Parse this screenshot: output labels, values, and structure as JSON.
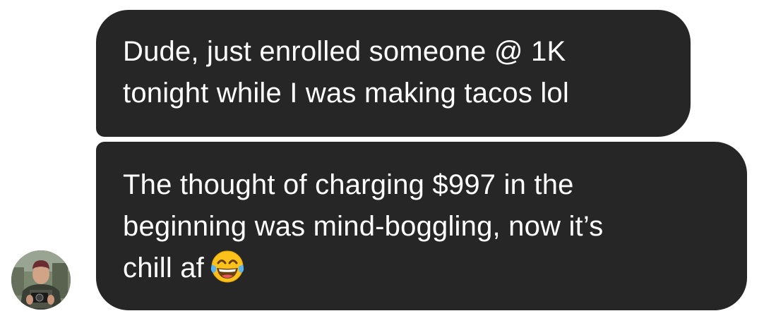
{
  "conversation": {
    "messages": [
      {
        "lines": [
          "Dude, just enrolled someone @ 1K",
          "tonight while I was making tacos lol"
        ]
      },
      {
        "lines": [
          "The thought of charging $997 in the",
          "beginning was mind-boggling, now it’s",
          "chill af"
        ],
        "emoji": "face-with-tears-of-joy-icon"
      }
    ],
    "avatar": "user-avatar-photo"
  },
  "colors": {
    "bubble": "#262626",
    "text": "#ffffff",
    "background": "#ffffff"
  }
}
